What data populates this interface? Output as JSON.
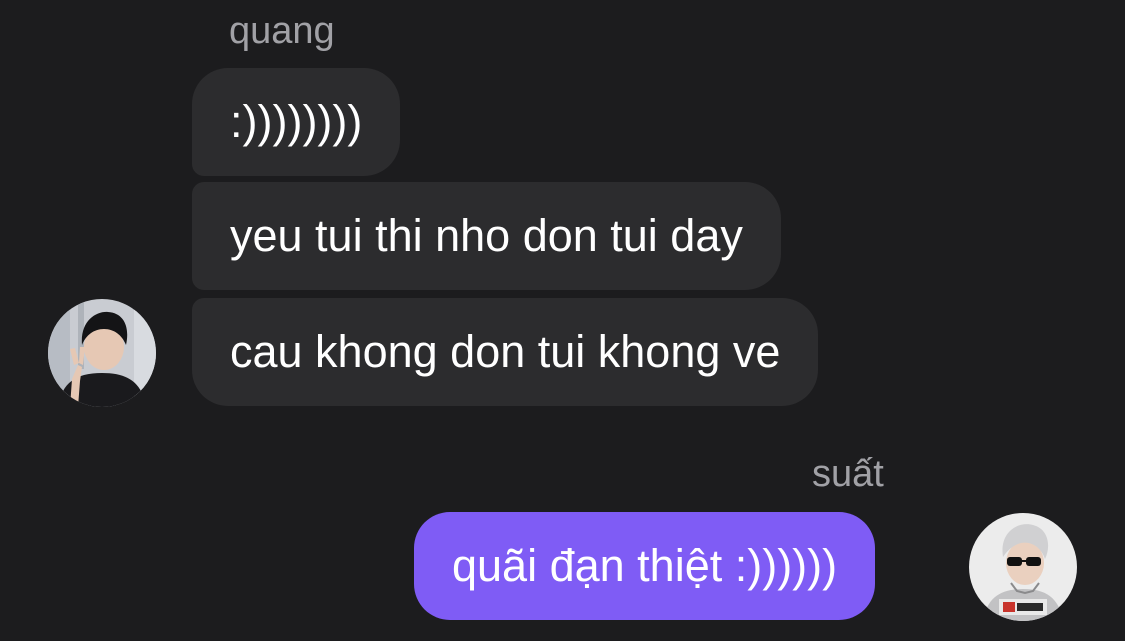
{
  "conversation": {
    "received_group": {
      "sender": "quang",
      "messages": [
        ":))))))))",
        "yeu tui thi nho don tui day",
        "cau khong don tui khong ve"
      ]
    },
    "sent_group": {
      "sender": "suất",
      "messages": [
        "quãi đạn thiệt :))))))"
      ],
      "bubble_color": "#7f5cf5"
    },
    "received_bubble_color": "#2c2c2e",
    "background_color": "#1c1c1e"
  }
}
